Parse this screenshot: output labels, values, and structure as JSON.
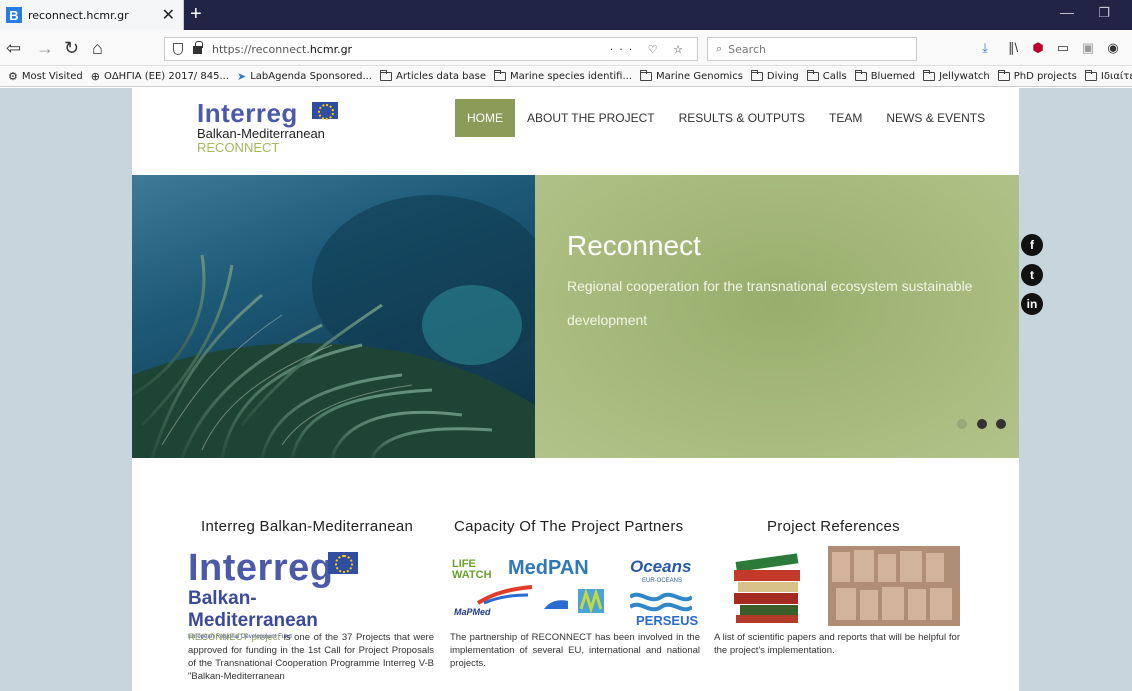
{
  "browser": {
    "tab_title": "reconnect.hcmr.gr",
    "tab_favicon": "B",
    "url_prefix": "https://reconnect.",
    "url_domain": "hcmr.gr",
    "url_actions": "··· ♡ ☆",
    "search_placeholder": "Search",
    "bookmarks": [
      {
        "label": "Most Visited",
        "icon": "gear-icon"
      },
      {
        "label": "ΟΔΗΓΙΑ (ΕΕ) 2017/ 845...",
        "icon": "globe-icon"
      },
      {
        "label": "LabAgenda Sponsored...",
        "icon": "arrow-icon"
      },
      {
        "label": "Articles data base",
        "icon": "folder-icon"
      },
      {
        "label": "Marine species identifi...",
        "icon": "folder-icon"
      },
      {
        "label": "Marine Genomics",
        "icon": "folder-icon"
      },
      {
        "label": "Diving",
        "icon": "folder-icon"
      },
      {
        "label": "Calls",
        "icon": "folder-icon"
      },
      {
        "label": "Bluemed",
        "icon": "folder-icon"
      },
      {
        "label": "Jellywatch",
        "icon": "folder-icon"
      },
      {
        "label": "PhD projects",
        "icon": "folder-icon"
      },
      {
        "label": "Ιδιαίτερα",
        "icon": "folder-icon"
      }
    ]
  },
  "site": {
    "logo": {
      "word": "Interreg",
      "program": "Balkan-Mediterranean",
      "project": "RECONNECT"
    },
    "menu": [
      "HOME",
      "ABOUT THE PROJECT",
      "RESULTS & OUTPUTS",
      "TEAM",
      "NEWS & EVENTS"
    ],
    "hero": {
      "title": "Reconnect",
      "text": "Regional cooperation for the transnational ecosystem sustainable development"
    },
    "social": [
      "f",
      "t",
      "in"
    ],
    "columns": {
      "interreg": {
        "title": "Interreg Balkan-Mediterranean",
        "logo_word": "Interreg",
        "logo_sub": "Balkan-Mediterranean",
        "logo_fund": "European Regional Development Fund",
        "text_link": "RECONNECT project",
        "text": " is one of the 37 Projects that were approved for funding in the 1st Call for Project Proposals of the Transnational Cooperation Programme Interreg V-B \"Balkan-Mediterranean"
      },
      "capacity": {
        "title": "Capacity Of The Project Partners",
        "logos": [
          "LIFE WATCH",
          "MedPAN",
          "Oceans",
          "EUR-OCEANS",
          "MaPMed",
          "PERSEUS"
        ],
        "text": "The partnership of RECONNECT has been involved in the implementation of several EU, international and national projects."
      },
      "references": {
        "title": "Project References",
        "text": "A list of scientific papers and reports that will be helpful for the project's implementation."
      }
    }
  }
}
